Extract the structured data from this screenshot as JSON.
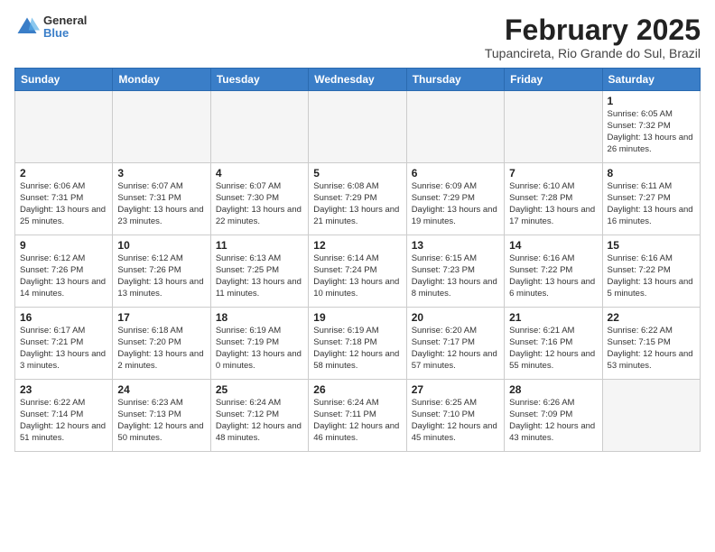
{
  "logo": {
    "general": "General",
    "blue": "Blue"
  },
  "header": {
    "month": "February 2025",
    "location": "Tupancireta, Rio Grande do Sul, Brazil"
  },
  "weekdays": [
    "Sunday",
    "Monday",
    "Tuesday",
    "Wednesday",
    "Thursday",
    "Friday",
    "Saturday"
  ],
  "weeks": [
    [
      {
        "day": "",
        "info": ""
      },
      {
        "day": "",
        "info": ""
      },
      {
        "day": "",
        "info": ""
      },
      {
        "day": "",
        "info": ""
      },
      {
        "day": "",
        "info": ""
      },
      {
        "day": "",
        "info": ""
      },
      {
        "day": "1",
        "info": "Sunrise: 6:05 AM\nSunset: 7:32 PM\nDaylight: 13 hours and 26 minutes."
      }
    ],
    [
      {
        "day": "2",
        "info": "Sunrise: 6:06 AM\nSunset: 7:31 PM\nDaylight: 13 hours and 25 minutes."
      },
      {
        "day": "3",
        "info": "Sunrise: 6:07 AM\nSunset: 7:31 PM\nDaylight: 13 hours and 23 minutes."
      },
      {
        "day": "4",
        "info": "Sunrise: 6:07 AM\nSunset: 7:30 PM\nDaylight: 13 hours and 22 minutes."
      },
      {
        "day": "5",
        "info": "Sunrise: 6:08 AM\nSunset: 7:29 PM\nDaylight: 13 hours and 21 minutes."
      },
      {
        "day": "6",
        "info": "Sunrise: 6:09 AM\nSunset: 7:29 PM\nDaylight: 13 hours and 19 minutes."
      },
      {
        "day": "7",
        "info": "Sunrise: 6:10 AM\nSunset: 7:28 PM\nDaylight: 13 hours and 17 minutes."
      },
      {
        "day": "8",
        "info": "Sunrise: 6:11 AM\nSunset: 7:27 PM\nDaylight: 13 hours and 16 minutes."
      }
    ],
    [
      {
        "day": "9",
        "info": "Sunrise: 6:12 AM\nSunset: 7:26 PM\nDaylight: 13 hours and 14 minutes."
      },
      {
        "day": "10",
        "info": "Sunrise: 6:12 AM\nSunset: 7:26 PM\nDaylight: 13 hours and 13 minutes."
      },
      {
        "day": "11",
        "info": "Sunrise: 6:13 AM\nSunset: 7:25 PM\nDaylight: 13 hours and 11 minutes."
      },
      {
        "day": "12",
        "info": "Sunrise: 6:14 AM\nSunset: 7:24 PM\nDaylight: 13 hours and 10 minutes."
      },
      {
        "day": "13",
        "info": "Sunrise: 6:15 AM\nSunset: 7:23 PM\nDaylight: 13 hours and 8 minutes."
      },
      {
        "day": "14",
        "info": "Sunrise: 6:16 AM\nSunset: 7:22 PM\nDaylight: 13 hours and 6 minutes."
      },
      {
        "day": "15",
        "info": "Sunrise: 6:16 AM\nSunset: 7:22 PM\nDaylight: 13 hours and 5 minutes."
      }
    ],
    [
      {
        "day": "16",
        "info": "Sunrise: 6:17 AM\nSunset: 7:21 PM\nDaylight: 13 hours and 3 minutes."
      },
      {
        "day": "17",
        "info": "Sunrise: 6:18 AM\nSunset: 7:20 PM\nDaylight: 13 hours and 2 minutes."
      },
      {
        "day": "18",
        "info": "Sunrise: 6:19 AM\nSunset: 7:19 PM\nDaylight: 13 hours and 0 minutes."
      },
      {
        "day": "19",
        "info": "Sunrise: 6:19 AM\nSunset: 7:18 PM\nDaylight: 12 hours and 58 minutes."
      },
      {
        "day": "20",
        "info": "Sunrise: 6:20 AM\nSunset: 7:17 PM\nDaylight: 12 hours and 57 minutes."
      },
      {
        "day": "21",
        "info": "Sunrise: 6:21 AM\nSunset: 7:16 PM\nDaylight: 12 hours and 55 minutes."
      },
      {
        "day": "22",
        "info": "Sunrise: 6:22 AM\nSunset: 7:15 PM\nDaylight: 12 hours and 53 minutes."
      }
    ],
    [
      {
        "day": "23",
        "info": "Sunrise: 6:22 AM\nSunset: 7:14 PM\nDaylight: 12 hours and 51 minutes."
      },
      {
        "day": "24",
        "info": "Sunrise: 6:23 AM\nSunset: 7:13 PM\nDaylight: 12 hours and 50 minutes."
      },
      {
        "day": "25",
        "info": "Sunrise: 6:24 AM\nSunset: 7:12 PM\nDaylight: 12 hours and 48 minutes."
      },
      {
        "day": "26",
        "info": "Sunrise: 6:24 AM\nSunset: 7:11 PM\nDaylight: 12 hours and 46 minutes."
      },
      {
        "day": "27",
        "info": "Sunrise: 6:25 AM\nSunset: 7:10 PM\nDaylight: 12 hours and 45 minutes."
      },
      {
        "day": "28",
        "info": "Sunrise: 6:26 AM\nSunset: 7:09 PM\nDaylight: 12 hours and 43 minutes."
      },
      {
        "day": "",
        "info": ""
      }
    ]
  ]
}
